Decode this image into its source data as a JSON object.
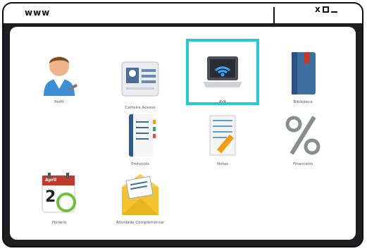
{
  "window": {
    "address": "www",
    "close": "x"
  },
  "apps": [
    {
      "label": "Perfil",
      "icon": "user-avatar-icon"
    },
    {
      "label": "Carteira Acesso",
      "icon": "id-card-icon"
    },
    {
      "label": "AVA",
      "icon": "laptop-wifi-icon"
    },
    {
      "label": "Biblioteca",
      "icon": "book-icon"
    },
    {
      "label": "Protocolo",
      "icon": "notebook-icon"
    },
    {
      "label": "Notas",
      "icon": "notepad-pencil-icon"
    },
    {
      "label": "Financeiro",
      "icon": "percent-icon"
    },
    {
      "label": "Horário",
      "icon": "calendar-clock-icon"
    },
    {
      "label": "Atividade Complementar",
      "icon": "mail-envelope-icon"
    }
  ],
  "calendar": {
    "month": "April",
    "day": "2"
  },
  "highlight_color": "#27c8d6"
}
